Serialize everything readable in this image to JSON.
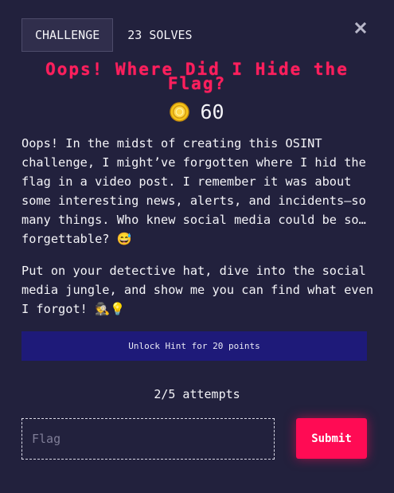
{
  "tabs": {
    "challenge_label": "CHALLENGE",
    "solves_label": "23 SOLVES"
  },
  "close_icon": "close-icon",
  "challenge": {
    "title": "Oops! Where Did I Hide the Flag?",
    "points": "60",
    "points_icon": "coin-icon",
    "description": [
      "Oops! In the midst of creating this OSINT challenge, I might’ve forgotten where I hid the flag in a video post. I remember it was about some interesting news, alerts, and incidents—so many things. Who knew social media could be so… forgettable? 😅",
      "Put on your detective hat, dive into the social media jungle, and show me you can find what even I forgot! 🕵️💡"
    ]
  },
  "hint": {
    "label": "Unlock Hint for 20 points"
  },
  "attempts": "2/5 attempts",
  "flag_form": {
    "placeholder": "Flag",
    "value": "",
    "submit_label": "Submit"
  },
  "colors": {
    "background": "#22213d",
    "title": "#ff1f5d",
    "hint_button": "#1e1a79",
    "submit_button": "#ff0b54",
    "coin": "#f5c518"
  }
}
